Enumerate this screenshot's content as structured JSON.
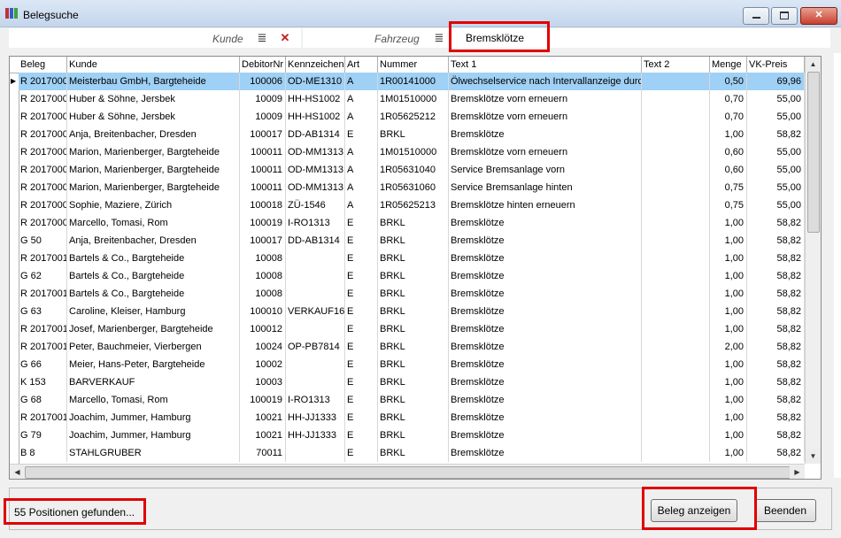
{
  "window": {
    "title": "Belegsuche"
  },
  "search": {
    "kunde_label": "Kunde",
    "fahrzeug_label": "Fahrzeug",
    "value": "Bremsklötze"
  },
  "columns": [
    "Beleg",
    "Kunde",
    "DebitorNr",
    "Kennzeichen",
    "Art",
    "Nummer",
    "Text 1",
    "Text 2",
    "Menge",
    "VK-Preis"
  ],
  "rows": [
    [
      "R 2017000",
      "Meisterbau GmbH, Bargteheide",
      "100006",
      "OD-ME1310",
      "A",
      "1R00141000",
      "Ölwechselservice nach Intervallanzeige durch",
      "",
      "0,50",
      "69,96"
    ],
    [
      "R 2017000",
      "Huber & Söhne, Jersbek",
      "10009",
      "HH-HS1002",
      "A",
      "1M01510000",
      "Bremsklötze vorn erneuern",
      "",
      "0,70",
      "55,00"
    ],
    [
      "R 2017000",
      "Huber & Söhne, Jersbek",
      "10009",
      "HH-HS1002",
      "A",
      "1R05625212",
      "Bremsklötze vorn erneuern",
      "",
      "0,70",
      "55,00"
    ],
    [
      "R 2017000",
      "Anja, Breitenbacher, Dresden",
      "100017",
      "DD-AB1314",
      "E",
      "BRKL",
      "Bremsklötze",
      "",
      "1,00",
      "58,82"
    ],
    [
      "R 2017000",
      "Marion, Marienberger, Bargteheide",
      "100011",
      "OD-MM1313",
      "A",
      "1M01510000",
      "Bremsklötze vorn erneuern",
      "",
      "0,60",
      "55,00"
    ],
    [
      "R 2017000",
      "Marion, Marienberger, Bargteheide",
      "100011",
      "OD-MM1313",
      "A",
      "1R05631040",
      "Service Bremsanlage vorn",
      "",
      "0,60",
      "55,00"
    ],
    [
      "R 2017000",
      "Marion, Marienberger, Bargteheide",
      "100011",
      "OD-MM1313",
      "A",
      "1R05631060",
      "Service Bremsanlage hinten",
      "",
      "0,75",
      "55,00"
    ],
    [
      "R 2017000",
      "Sophie, Maziere, Zürich",
      "100018",
      "ZÜ-1546",
      "A",
      "1R05625213",
      "Bremsklötze hinten erneuern",
      "",
      "0,75",
      "55,00"
    ],
    [
      "R 2017000",
      "Marcello, Tomasi, Rom",
      "100019",
      "I-RO1313",
      "E",
      "BRKL",
      "Bremsklötze",
      "",
      "1,00",
      "58,82"
    ],
    [
      "G 50",
      "Anja, Breitenbacher, Dresden",
      "100017",
      "DD-AB1314",
      "E",
      "BRKL",
      "Bremsklötze",
      "",
      "1,00",
      "58,82"
    ],
    [
      "R 2017001",
      "Bartels & Co., Bargteheide",
      "10008",
      "",
      "E",
      "BRKL",
      "Bremsklötze",
      "",
      "1,00",
      "58,82"
    ],
    [
      "G 62",
      "Bartels & Co., Bargteheide",
      "10008",
      "",
      "E",
      "BRKL",
      "Bremsklötze",
      "",
      "1,00",
      "58,82"
    ],
    [
      "R 2017001",
      "Bartels & Co., Bargteheide",
      "10008",
      "",
      "E",
      "BRKL",
      "Bremsklötze",
      "",
      "1,00",
      "58,82"
    ],
    [
      "G 63",
      "Caroline, Kleiser, Hamburg",
      "100010",
      "VERKAUF16",
      "E",
      "BRKL",
      "Bremsklötze",
      "",
      "1,00",
      "58,82"
    ],
    [
      "R 2017001",
      "Josef, Marienberger, Bargteheide",
      "100012",
      "",
      "E",
      "BRKL",
      "Bremsklötze",
      "",
      "1,00",
      "58,82"
    ],
    [
      "R 2017001",
      "Peter, Bauchmeier, Vierbergen",
      "10024",
      "OP-PB7814",
      "E",
      "BRKL",
      "Bremsklötze",
      "",
      "2,00",
      "58,82"
    ],
    [
      "G 66",
      "Meier, Hans-Peter, Bargteheide",
      "10002",
      "",
      "E",
      "BRKL",
      "Bremsklötze",
      "",
      "1,00",
      "58,82"
    ],
    [
      "K 153",
      "BARVERKAUF",
      "10003",
      "",
      "E",
      "BRKL",
      "Bremsklötze",
      "",
      "1,00",
      "58,82"
    ],
    [
      "G 68",
      "Marcello, Tomasi, Rom",
      "100019",
      "I-RO1313",
      "E",
      "BRKL",
      "Bremsklötze",
      "",
      "1,00",
      "58,82"
    ],
    [
      "R 2017001",
      "Joachim, Jummer, Hamburg",
      "10021",
      "HH-JJ1333",
      "E",
      "BRKL",
      "Bremsklötze",
      "",
      "1,00",
      "58,82"
    ],
    [
      "G 79",
      "Joachim, Jummer, Hamburg",
      "10021",
      "HH-JJ1333",
      "E",
      "BRKL",
      "Bremsklötze",
      "",
      "1,00",
      "58,82"
    ],
    [
      "B 8",
      "STAHLGRUBER",
      "70011",
      "",
      "E",
      "BRKL",
      "Bremsklötze",
      "",
      "1,00",
      "58,82"
    ]
  ],
  "status": {
    "text": "55 Positionen gefunden..."
  },
  "buttons": {
    "show_label": "Beleg anzeigen",
    "close_label": "Beenden"
  },
  "icons": {
    "list": "list-icon",
    "clear": "clear-x-icon",
    "row_pointer": "row-pointer-icon"
  },
  "colors": {
    "selected_row": "#9fd0f5",
    "highlight": "#e00000"
  }
}
